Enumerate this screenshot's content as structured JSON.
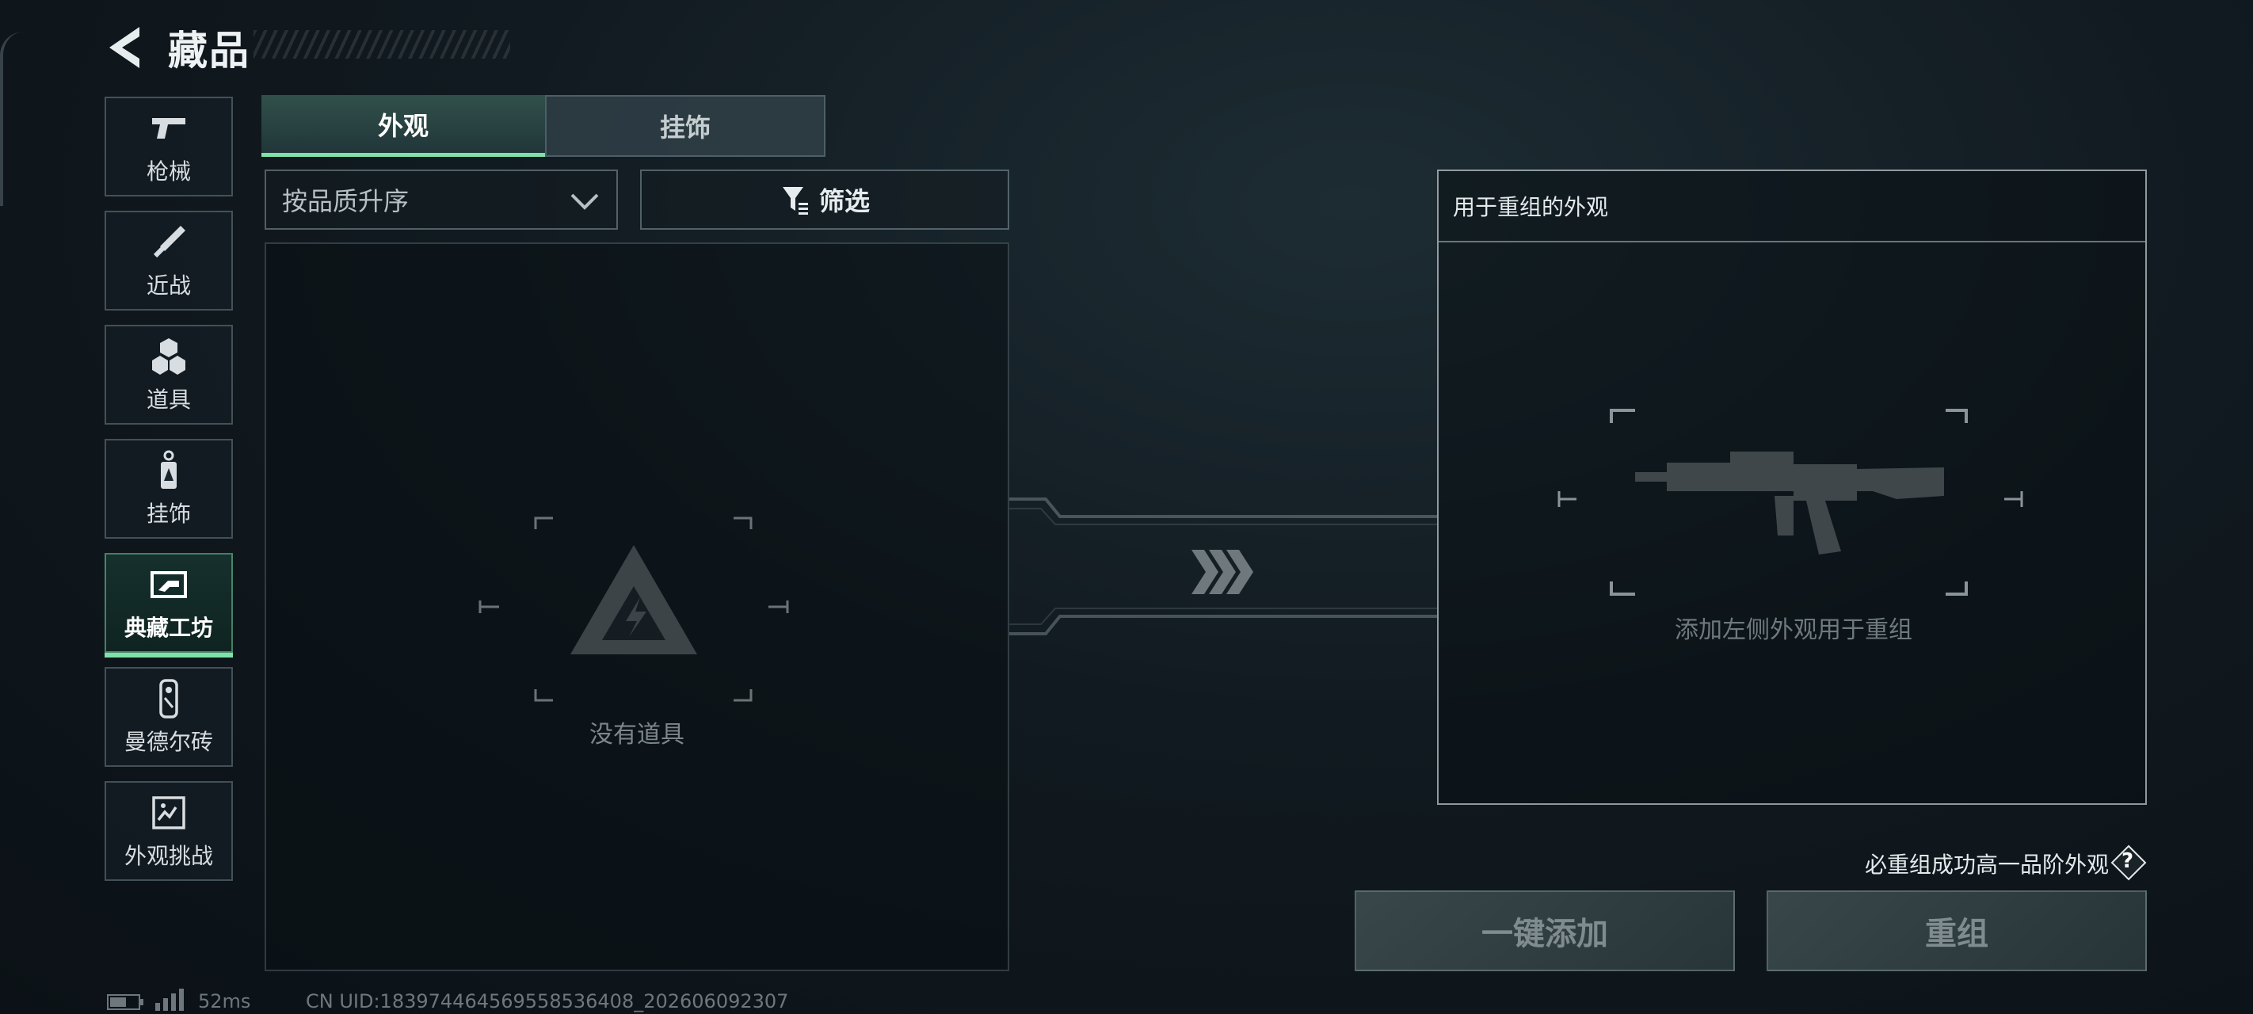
{
  "header": {
    "title": "藏品"
  },
  "sidebar": {
    "items": [
      {
        "label": "枪械",
        "icon": "pistol-icon"
      },
      {
        "label": "近战",
        "icon": "knife-icon"
      },
      {
        "label": "道具",
        "icon": "grenade-icon"
      },
      {
        "label": "挂饰",
        "icon": "charm-icon"
      },
      {
        "label": "典藏工坊",
        "icon": "workshop-icon",
        "active": true
      },
      {
        "label": "曼德尔砖",
        "icon": "brick-icon"
      },
      {
        "label": "外观挑战",
        "icon": "challenge-icon"
      }
    ]
  },
  "tabs": [
    {
      "label": "外观",
      "active": true
    },
    {
      "label": "挂饰",
      "active": false
    }
  ],
  "sort": {
    "selected": "按品质升序"
  },
  "filter": {
    "label": "筛选"
  },
  "inventory": {
    "empty_text": "没有道具"
  },
  "recombine": {
    "title": "用于重组的外观",
    "hint": "添加左侧外观用于重组",
    "guarantee": "必重组成功高一品阶外观",
    "help": "?",
    "add_all_label": "一键添加",
    "recombine_label": "重组"
  },
  "status": {
    "ping": "52ms",
    "uid": "CN UID:183974464569558536408_202606092307"
  },
  "colors": {
    "accent": "#7fe0a8",
    "background": "#111a20"
  }
}
